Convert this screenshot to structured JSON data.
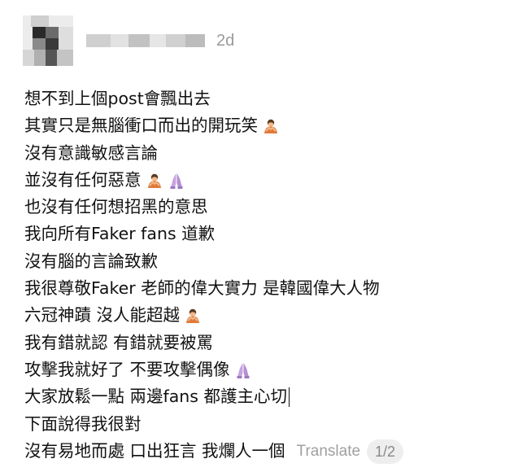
{
  "header": {
    "username": "",
    "time": "2d"
  },
  "post": {
    "lines": [
      {
        "text": "想不到上個post會飄出去",
        "emoji": []
      },
      {
        "text": "其實只是無腦衝口而出的開玩笑",
        "emoji": [
          "person-bowing-emoji"
        ]
      },
      {
        "text": "沒有意識敏感言論",
        "emoji": []
      },
      {
        "text": "並沒有任何惡意",
        "emoji": [
          "person-bowing-emoji",
          "folded-hands-emoji"
        ]
      },
      {
        "text": "也沒有任何想招黑的意思",
        "emoji": []
      },
      {
        "text": "我向所有Faker fans 道歉",
        "emoji": []
      },
      {
        "text": "沒有腦的言論致歉",
        "emoji": []
      },
      {
        "text": "我很尊敬Faker 老師的偉大實力 是韓國偉大人物",
        "emoji": []
      },
      {
        "text": "六冠神蹟 沒人能超越",
        "emoji": [
          "person-bowing-emoji"
        ]
      },
      {
        "text": "我有錯就認 有錯就要被罵",
        "emoji": []
      },
      {
        "text": "攻擊我就好了 不要攻擊偶像",
        "emoji": [
          "folded-hands-emoji"
        ]
      },
      {
        "text": "大家放鬆一點 兩邊fans 都護主心切",
        "emoji": [],
        "cursor": true
      },
      {
        "text": "下面說得我很對",
        "emoji": []
      },
      {
        "text": "沒有易地而處 口出狂言 我爛人一個",
        "emoji": []
      }
    ],
    "translate_label": "Translate",
    "page_indicator": "1/2"
  },
  "colors": {
    "text": "#111111",
    "muted": "#9a9a9a",
    "pill_bg": "#eeeeee",
    "bowing_emoji": "#e07a3a",
    "folded_hands": "#c7a4e0"
  }
}
